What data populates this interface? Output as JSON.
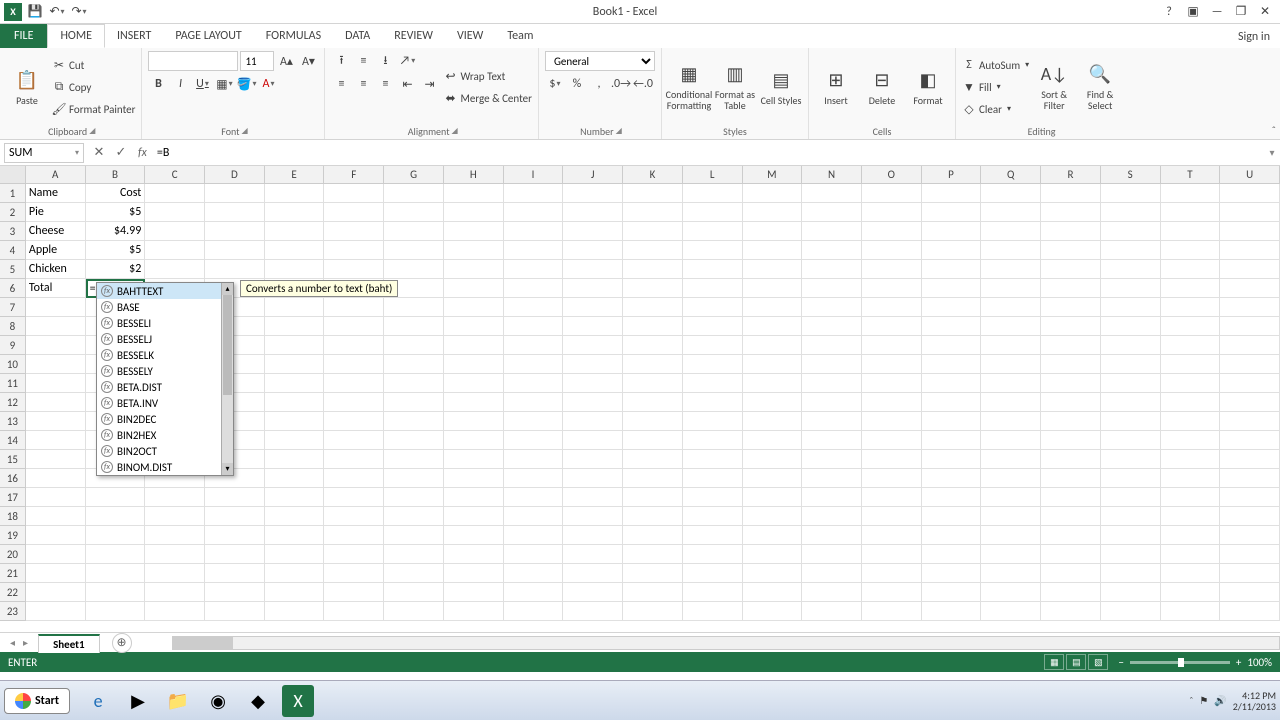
{
  "title": "Book1 - Excel",
  "qat": {
    "save": "💾",
    "undo": "↶",
    "redo": "↷"
  },
  "tabs": [
    "FILE",
    "HOME",
    "INSERT",
    "PAGE LAYOUT",
    "FORMULAS",
    "DATA",
    "REVIEW",
    "VIEW",
    "Team"
  ],
  "active_tab": "HOME",
  "signin": "Sign in",
  "ribbon": {
    "clipboard": {
      "label": "Clipboard",
      "paste": "Paste",
      "cut": "Cut",
      "copy": "Copy",
      "fmt": "Format Painter"
    },
    "font": {
      "label": "Font",
      "name": "",
      "size": "11",
      "bold": "B",
      "italic": "I",
      "underline": "U"
    },
    "alignment": {
      "label": "Alignment",
      "wrap": "Wrap Text",
      "merge": "Merge & Center"
    },
    "number": {
      "label": "Number",
      "general": "General"
    },
    "styles": {
      "label": "Styles",
      "cf": "Conditional Formatting",
      "fat": "Format as Table",
      "cs": "Cell Styles"
    },
    "cells": {
      "label": "Cells",
      "insert": "Insert",
      "delete": "Delete",
      "format": "Format"
    },
    "editing": {
      "label": "Editing",
      "sum": "AutoSum",
      "fill": "Fill",
      "clear": "Clear",
      "sort": "Sort & Filter",
      "find": "Find & Select"
    }
  },
  "namebox": "SUM",
  "formula": "=B",
  "columns": [
    "A",
    "B",
    "C",
    "D",
    "E",
    "F",
    "G",
    "H",
    "I",
    "J",
    "K",
    "L",
    "M",
    "N",
    "O",
    "P",
    "Q",
    "R",
    "S",
    "T",
    "U"
  ],
  "row_count": 23,
  "cells": {
    "A1": "Name",
    "B1": "Cost",
    "A2": "Pie",
    "B2": "$5",
    "A3": "Cheese",
    "B3": "$4.99",
    "A4": "Apple",
    "B4": "$5",
    "A5": "Chicken",
    "B5": "$2",
    "A6": "Total",
    "B6": "=B"
  },
  "editing_cell": "B6",
  "functions": [
    "BAHTTEXT",
    "BASE",
    "BESSELI",
    "BESSELJ",
    "BESSELK",
    "BESSELY",
    "BETA.DIST",
    "BETA.INV",
    "BIN2DEC",
    "BIN2HEX",
    "BIN2OCT",
    "BINOM.DIST"
  ],
  "func_selected": 0,
  "tooltip": "Converts a number to text (baht)",
  "sheet": "Sheet1",
  "status": "ENTER",
  "zoom": "100%",
  "clock": {
    "time": "4:12 PM",
    "date": "2/11/2013"
  }
}
